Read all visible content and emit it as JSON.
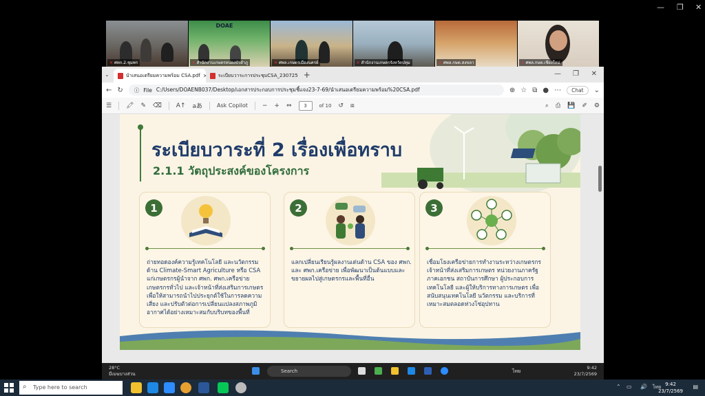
{
  "zoom": {
    "participants": [
      {
        "name": "ศทก.2.ชุมพร"
      },
      {
        "name": "สำนักงานเกษตรหนองบัวลำภู"
      },
      {
        "name": "ศพล.เกษตรเมืองนครย์"
      },
      {
        "name": "สำนักงานเกษตรจังหวัดปทุม"
      },
      {
        "name": "ศพล.กษต.สงขลา"
      },
      {
        "name": "ศพล.กษต.เชียงใหม่"
      }
    ],
    "tile_banner": "DOAE"
  },
  "browser": {
    "tabs": [
      {
        "label": "นำเสนอเตรียมความพร้อม CSA.pdf",
        "active": true
      },
      {
        "label": "ระเบียบวาระการประชุมCSA_2307256",
        "active": false
      }
    ],
    "url_prefix": "File",
    "url": "C:/Users/DOAENB037/Desktop/เอกสารประกอบการประชุมชี้แจง23-7-69/นำเสนอเตรียมความพร้อม%20CSA.pdf",
    "chat_label": "Chat",
    "ask_copilot": "Ask Copilot",
    "page_current": "3",
    "page_total": "of 10"
  },
  "slide": {
    "title": "ระเบียบวาระที่ 2 เรื่องเพื่อทราบ",
    "subtitle": "2.1.1 วัตถุประสงค์ของโครงการ",
    "cards": [
      {
        "number": "1",
        "text": "ถ่ายทอดองค์ความรู้เทคโนโลยี และนวัตกรรมด้าน Climate-Smart Agriculture หรือ CSA แก่เกษตรกรผู้นำจาก ศพก. ศพก.เครือข่าย เกษตรกรทั่วไป และเจ้าหน้าที่ส่งเสริมการเกษตร เพื่อให้สามารถนำไปประยุกต์ใช้ในการลดความเสี่ยง และปรับตัวต่อการเปลี่ยนแปลงสภาพภูมิอากาศได้อย่างเหมาะสมกับบริบทของพื้นที่"
      },
      {
        "number": "2",
        "text": "แลกเปลี่ยนเรียนรู้ผลงานเด่นด้าน CSA ของ ศพก. และ ศพก.เครือข่าย เพื่อพัฒนาเป็นต้นแบบและขยายผลไปสู่เกษตรกรและพื้นที่อื่น"
      },
      {
        "number": "3",
        "text": "เชื่อมโยงเครือข่ายการทำงานระหว่างเกษตรกร เจ้าหน้าที่ส่งเสริมการเกษตร หน่วยงานภาครัฐ ภาคเอกชน สถาบันการศึกษา ผู้ประกอบการเทคโนโลยี และผู้ให้บริการทางการเกษตร เพื่อสนับสนุนเทคโนโลยี นวัตกรรม และบริการที่เหมาะสมตลอดห่วงโซ่อุปทาน"
      }
    ]
  },
  "inner_taskbar": {
    "temperature": "28°C",
    "weather": "มีเมฆบางส่วน",
    "search": "Search",
    "lang": "ไทย",
    "time": "9:42",
    "date": "23/7/2569"
  },
  "taskbar": {
    "search_placeholder": "Type here to search",
    "lang": "ไทย",
    "time": "9:42",
    "date": "23/7/2569"
  },
  "colors": {
    "title": "#1f3b6a",
    "accent_green": "#3c6f36",
    "slide_bg": "#fbf4e4",
    "taskbar": "#1c2b3a"
  }
}
